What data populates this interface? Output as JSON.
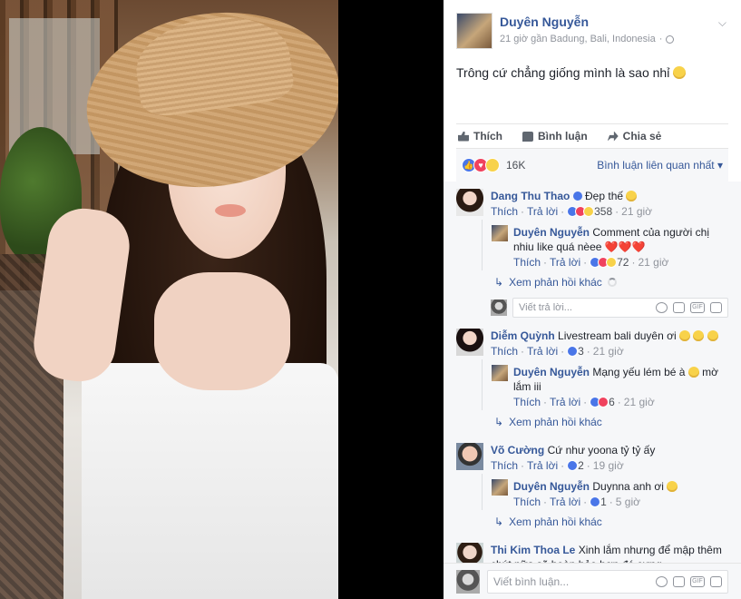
{
  "post": {
    "author": "Duyên Nguyễn",
    "meta": "21 giờ gần Badung, Bali, Indonesia",
    "text": "Trông cứ chẳng giống mình là sao nhỉ"
  },
  "actions": {
    "like": "Thích",
    "comment": "Bình luận",
    "share": "Chia sẻ"
  },
  "reactions": {
    "count": "16K",
    "sort": "Bình luận liên quan nhất ▾"
  },
  "comments": [
    {
      "name": "Dang Thu Thao",
      "text": "Đẹp thế",
      "like": "Thích",
      "reply": "Trả lời",
      "count": "358",
      "time": "21 giờ",
      "replies": [
        {
          "name": "Duyên Nguyễn",
          "text": "Comment của người chị nhiu like quá nèee ❤️❤️❤️",
          "like": "Thích",
          "reply": "Trả lời",
          "count": "72",
          "time": "21 giờ"
        }
      ],
      "more": "Xem phản hồi khác",
      "reply_placeholder": "Viết trả lời..."
    },
    {
      "name": "Diễm Quỳnh",
      "text": "Livestream bali duyên ơi",
      "like": "Thích",
      "reply": "Trả lời",
      "count": "3",
      "time": "21 giờ",
      "replies": [
        {
          "name": "Duyên Nguyễn",
          "text": "Mạng yếu lém bé à",
          "text_after": "mờ lắm iii",
          "like": "Thích",
          "reply": "Trả lời",
          "count": "6",
          "time": "21 giờ"
        }
      ],
      "more": "Xem phản hồi khác"
    },
    {
      "name": "Võ Cường",
      "text": "Cứ như yoona tỷ tỷ ấy",
      "like": "Thích",
      "reply": "Trả lời",
      "count": "2",
      "time": "19 giờ",
      "replies": [
        {
          "name": "Duyên Nguyễn",
          "text": "Duynna anh ơi",
          "like": "Thích",
          "reply": "Trả lời",
          "count": "1",
          "time": "5 giờ"
        }
      ],
      "more": "Xem phản hồi khác"
    },
    {
      "name": "Thi Kim Thoa Le",
      "text": "Xinh lắm nhưng để mập thêm chút nữa sẽ hoàn hảo hơn đó cưng"
    }
  ],
  "composer": {
    "placeholder": "Viết bình luận...",
    "gif": "GIF"
  },
  "colors": {
    "link": "#365899",
    "meta": "#90949c",
    "like_blue": "#4a76e8",
    "love_red": "#f0425e"
  }
}
